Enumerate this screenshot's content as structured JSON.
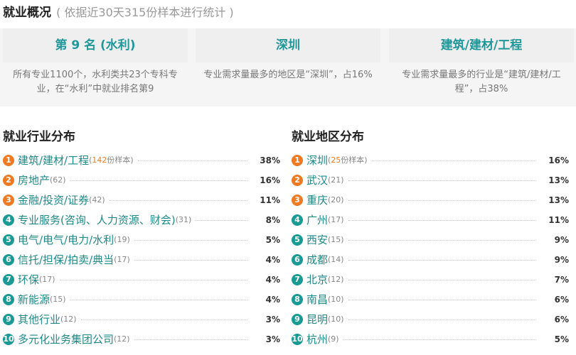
{
  "header": {
    "title": "就业概况",
    "subtitle": "( 依据近30天315份样本进行统计 )"
  },
  "cards": [
    {
      "head": "第 9 名 (水利)",
      "desc": "所有专业1100个，水利类共23个专科专业，在“水利”中就业排名第9"
    },
    {
      "head": "深圳",
      "desc": "专业需求量最多的地区是“深圳”，占16%"
    },
    {
      "head": "建筑/建材/工程",
      "desc": "专业需求量最多的行业是“建筑/建材/工程”，占38%"
    }
  ],
  "industry": {
    "title": "就业行业分布",
    "items": [
      {
        "rank": "1",
        "name": "建筑/建材/工程",
        "count": "142",
        "count_suffix": "份样本",
        "pct": "38%"
      },
      {
        "rank": "2",
        "name": "房地产",
        "count": "(62)",
        "pct": "16%"
      },
      {
        "rank": "3",
        "name": "金融/投资/证券",
        "count": "(42)",
        "pct": "11%"
      },
      {
        "rank": "4",
        "name": "专业服务(咨询、人力资源、财会)",
        "count": "(31)",
        "pct": "8%"
      },
      {
        "rank": "5",
        "name": "电气/电气/电力/水利",
        "count": "(19)",
        "pct": "5%"
      },
      {
        "rank": "6",
        "name": "信托/担保/拍卖/典当",
        "count": "(17)",
        "pct": "4%"
      },
      {
        "rank": "7",
        "name": "环保",
        "count": "(17)",
        "pct": "4%"
      },
      {
        "rank": "8",
        "name": "新能源",
        "count": "(15)",
        "pct": "4%"
      },
      {
        "rank": "9",
        "name": "其他行业",
        "count": "(12)",
        "pct": "3%"
      },
      {
        "rank": "10",
        "name": "多元化业务集团公司",
        "count": "(12)",
        "pct": "3%"
      }
    ]
  },
  "region": {
    "title": "就业地区分布",
    "items": [
      {
        "rank": "1",
        "name": "深圳",
        "count": "25",
        "count_suffix": "份样本",
        "pct": "16%"
      },
      {
        "rank": "2",
        "name": "武汉",
        "count": "(21)",
        "pct": "13%"
      },
      {
        "rank": "3",
        "name": "重庆",
        "count": "(20)",
        "pct": "13%"
      },
      {
        "rank": "4",
        "name": "广州",
        "count": "(17)",
        "pct": "11%"
      },
      {
        "rank": "5",
        "name": "西安",
        "count": "(15)",
        "pct": "9%"
      },
      {
        "rank": "6",
        "name": "成都",
        "count": "(14)",
        "pct": "9%"
      },
      {
        "rank": "7",
        "name": "北京",
        "count": "(12)",
        "pct": "7%"
      },
      {
        "rank": "8",
        "name": "南昌",
        "count": "(10)",
        "pct": "6%"
      },
      {
        "rank": "9",
        "name": "昆明",
        "count": "(10)",
        "pct": "6%"
      },
      {
        "rank": "10",
        "name": "杭州",
        "count": "(9)",
        "pct": "5%"
      }
    ]
  },
  "colors": {
    "accent": "#1a9a95",
    "top_rank": "#f07a22"
  }
}
